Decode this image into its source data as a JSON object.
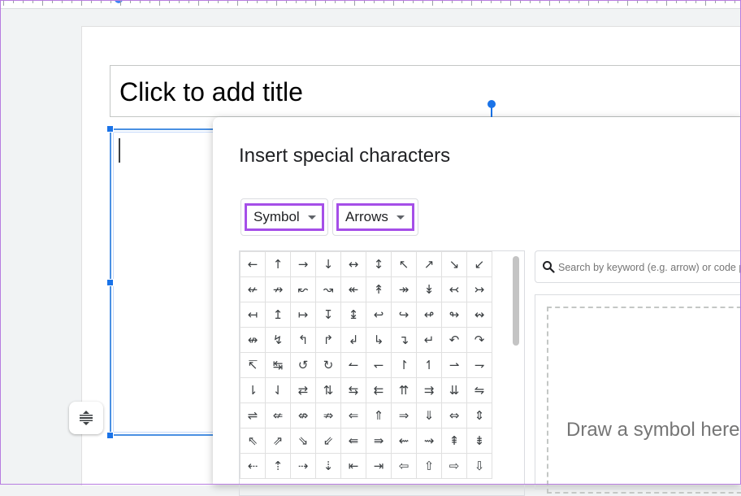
{
  "slide": {
    "title_placeholder": "Click to add title"
  },
  "dialog": {
    "title": "Insert special characters",
    "category_dropdown": "Symbol",
    "subcategory_dropdown": "Arrows",
    "search_placeholder": "Search by keyword (e.g. arrow) or code point",
    "draw_hint": "Draw a symbol here",
    "symbols": [
      [
        "←",
        "↑",
        "→",
        "↓",
        "↔",
        "↕",
        "↖",
        "↗",
        "↘",
        "↙"
      ],
      [
        "↚",
        "↛",
        "↜",
        "↝",
        "↞",
        "↟",
        "↠",
        "↡",
        "↢",
        "↣"
      ],
      [
        "↤",
        "↥",
        "↦",
        "↧",
        "↨",
        "↩",
        "↪",
        "↫",
        "↬",
        "↭"
      ],
      [
        "↮",
        "↯",
        "↰",
        "↱",
        "↲",
        "↳",
        "↴",
        "↵",
        "↶",
        "↷"
      ],
      [
        "↸",
        "↹",
        "↺",
        "↻",
        "↼",
        "↽",
        "↾",
        "↿",
        "⇀",
        "⇁"
      ],
      [
        "⇂",
        "⇃",
        "⇄",
        "⇅",
        "⇆",
        "⇇",
        "⇈",
        "⇉",
        "⇊",
        "⇋"
      ],
      [
        "⇌",
        "⇍",
        "⇎",
        "⇏",
        "⇐",
        "⇑",
        "⇒",
        "⇓",
        "⇔",
        "⇕"
      ],
      [
        "⇖",
        "⇗",
        "⇘",
        "⇙",
        "⇚",
        "⇛",
        "⇜",
        "⇝",
        "⇞",
        "⇟"
      ],
      [
        "⇠",
        "⇡",
        "⇢",
        "⇣",
        "⇤",
        "⇥",
        "⇦",
        "⇧",
        "⇨",
        "⇩"
      ]
    ]
  },
  "icons": {
    "search": "search-icon",
    "line_spacing": "line-spacing-icon"
  },
  "colors": {
    "highlight": "#a54fe8",
    "selection": "#1a73e8"
  }
}
